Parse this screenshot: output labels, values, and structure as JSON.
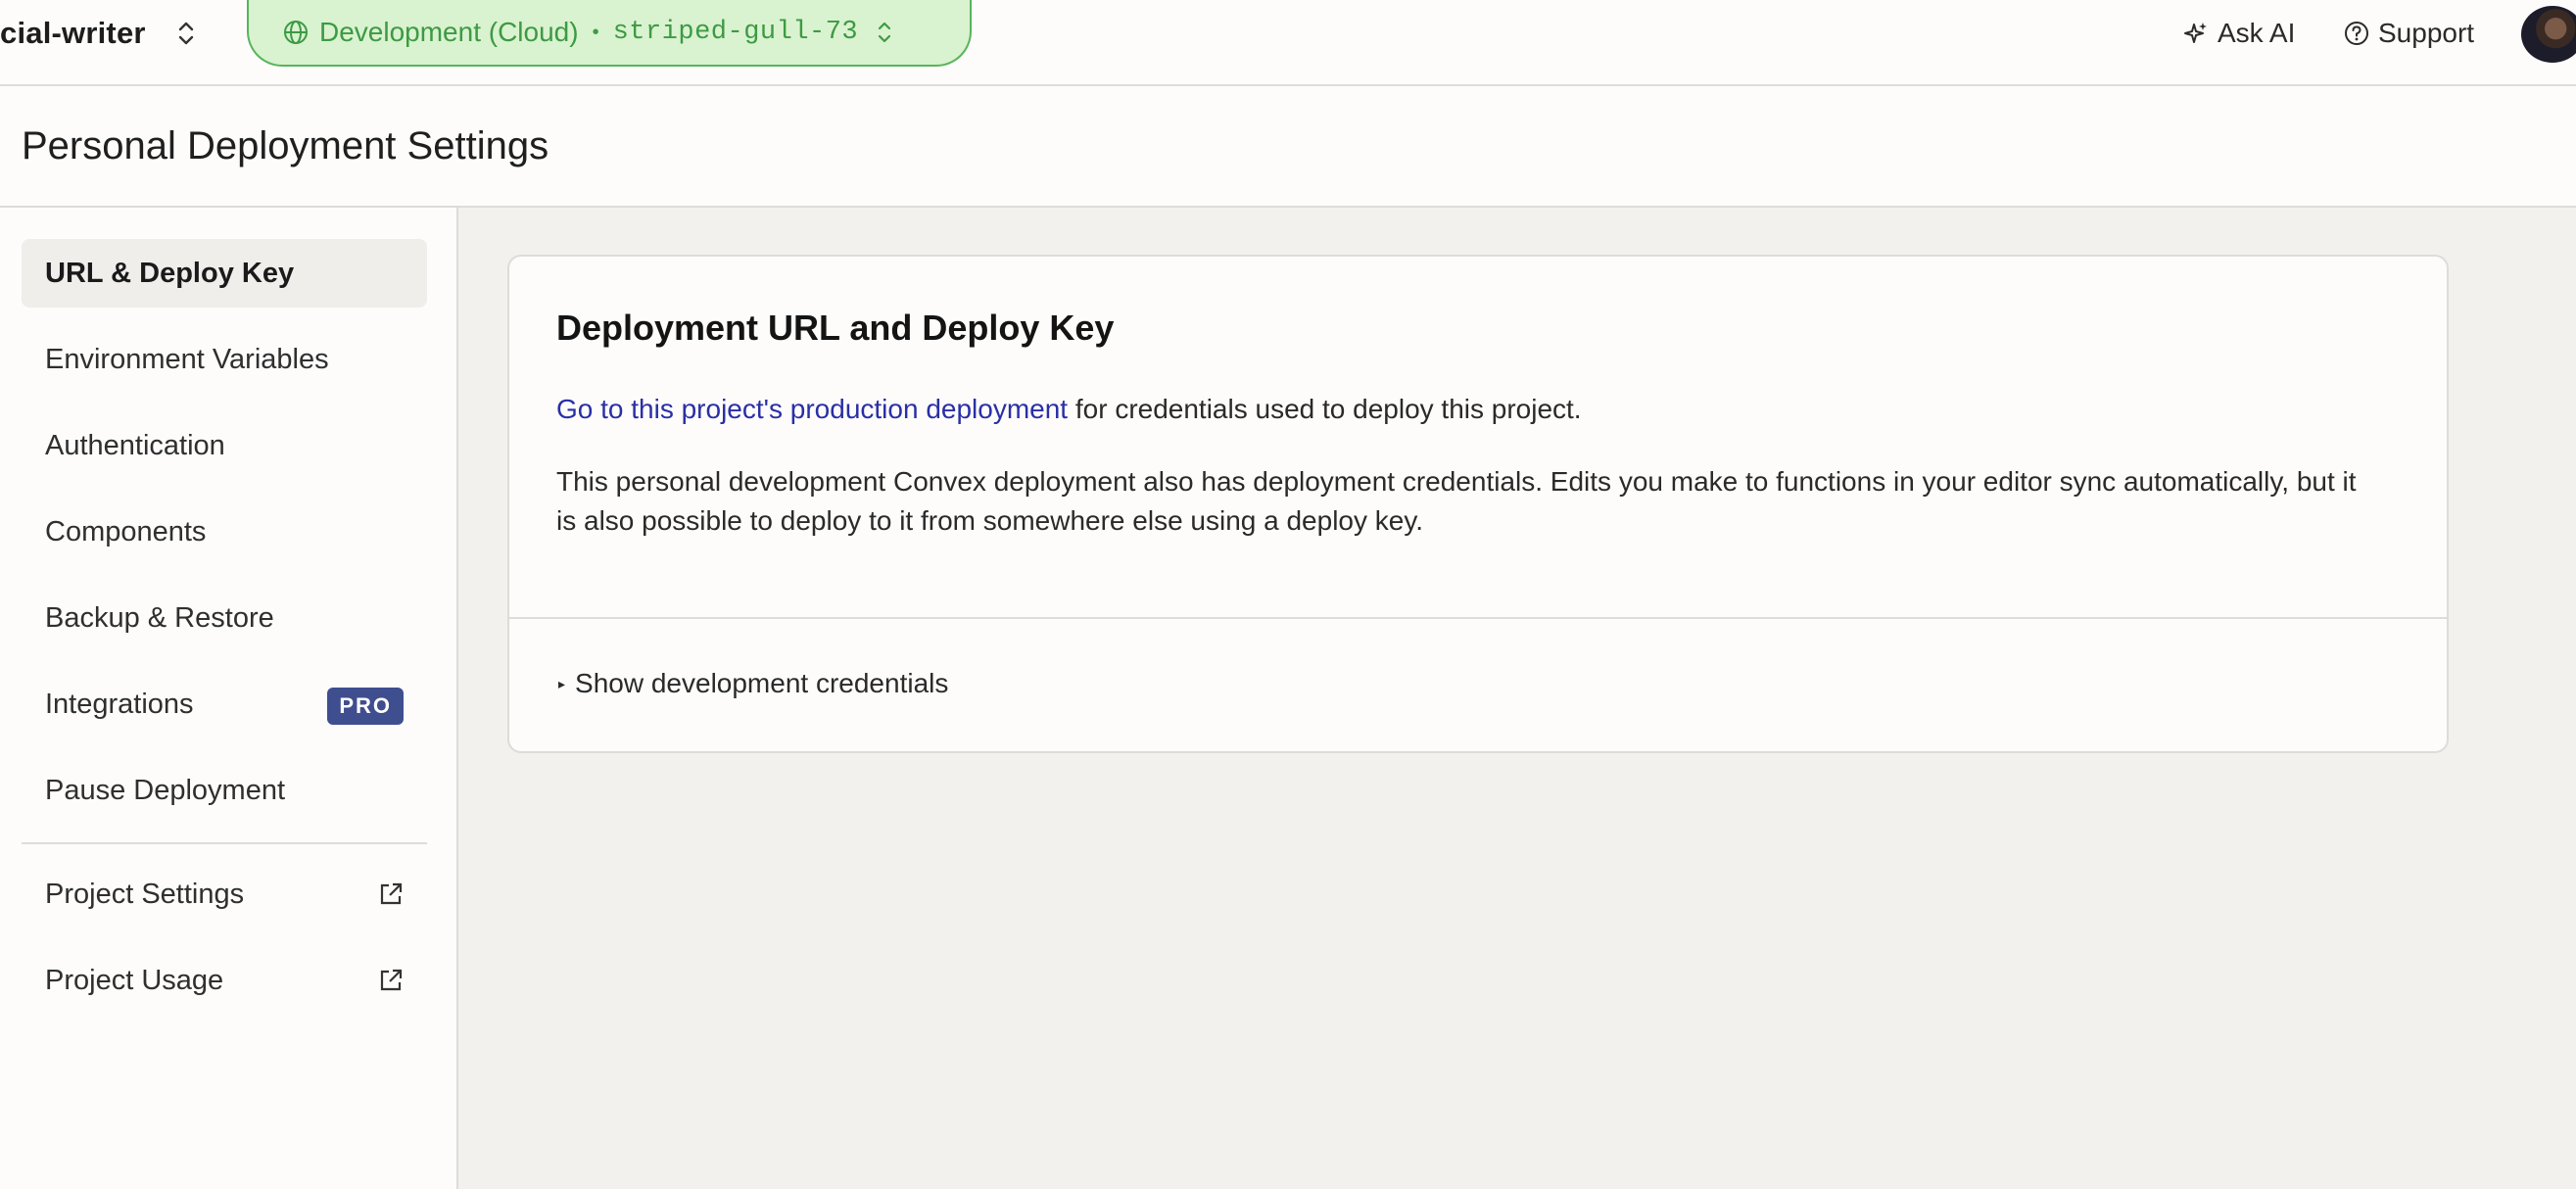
{
  "topbar": {
    "project_name": "cial-writer",
    "environment": {
      "label": "Development (Cloud)",
      "separator": "•",
      "deployment_name": "striped-gull-73"
    },
    "ask_ai_label": "Ask AI",
    "support_label": "Support"
  },
  "header": {
    "title": "Personal Deployment Settings"
  },
  "sidebar": {
    "items": [
      {
        "label": "URL & Deploy Key",
        "active": true
      },
      {
        "label": "Environment Variables"
      },
      {
        "label": "Authentication"
      },
      {
        "label": "Components"
      },
      {
        "label": "Backup & Restore"
      },
      {
        "label": "Integrations",
        "badge": "PRO"
      },
      {
        "label": "Pause Deployment"
      }
    ],
    "external_items": [
      {
        "label": "Project Settings",
        "icon": "external-link-icon"
      },
      {
        "label": "Project Usage",
        "icon": "external-link-icon"
      }
    ]
  },
  "card": {
    "title": "Deployment URL and Deploy Key",
    "link_text": "Go to this project's production deployment",
    "link_suffix": " for credentials used to deploy this project.",
    "description": "This personal development Convex deployment also has deployment credentials. Edits you make to functions in your editor sync automatically, but it is also possible to deploy to it from somewhere else using a deploy key.",
    "disclosure_label": "Show development credentials",
    "disclosure_marker": "▸"
  },
  "colors": {
    "env_pill_bg": "#d9f2cf",
    "env_pill_text": "#3d9a44",
    "link": "#2a2fa6",
    "pro_badge": "#3f4e8f",
    "page_bg": "#f2f1ee"
  }
}
